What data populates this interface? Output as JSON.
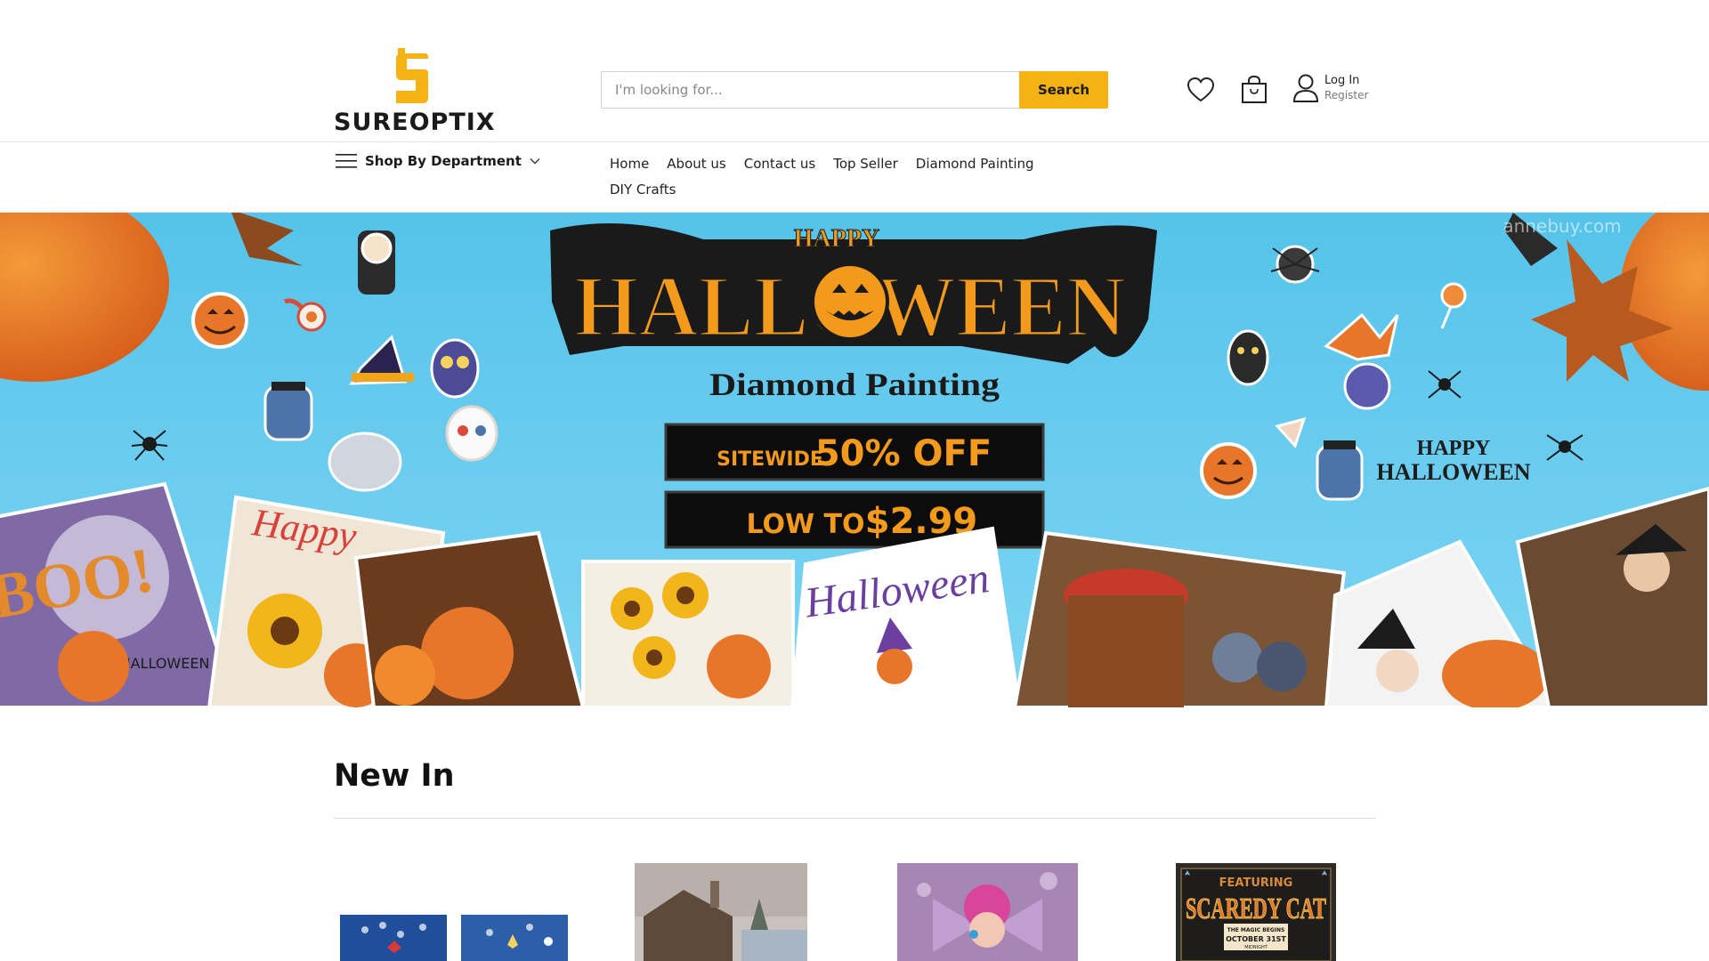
{
  "brand": {
    "name": "SUREOPTIX",
    "logo_letter": "S",
    "accent_color": "#f5b313"
  },
  "search": {
    "placeholder": "I'm looking for...",
    "button_label": "Search"
  },
  "header_icons": [
    "heart-icon",
    "shopping-bag-icon",
    "user-icon"
  ],
  "account": {
    "login_label": "Log In",
    "register_label": "Register"
  },
  "nav": {
    "department_label": "Shop By Department",
    "items": [
      "Home",
      "About us",
      "Contact us",
      "Top Seller",
      "Diamond Painting",
      "DIY Crafts"
    ]
  },
  "banner": {
    "happy": "HAPPY",
    "headline": "HALLOWEEN",
    "subtitle": "Diamond Painting",
    "offer_prefix": "SITEWIDE",
    "offer_main": "50% OFF",
    "price_prefix": "LOW TO",
    "price_value": "$2.99",
    "watermark": "annebuy.com",
    "side_text_1": "HAPPY",
    "side_text_2": "HALLOWEEN",
    "card_text_boo": "BOO!",
    "card_text_halloween": "HALLOWEEN",
    "card_text_happy": "Happy",
    "card_text_halloween_script": "Halloween",
    "background_color": "#5bc6ec"
  },
  "new_in": {
    "title": "New In",
    "products": [
      {
        "name": "product-blue-flower-mandala"
      },
      {
        "name": "product-cabin-landscape"
      },
      {
        "name": "product-pink-fairy"
      },
      {
        "name": "product-scaredy-cat",
        "poster_top": "FEATURING",
        "poster_title": "SCAREDY CAT",
        "poster_line1": "THE MAGIC BEGINS",
        "poster_line2": "OCTOBER 31ST",
        "poster_line3": "MIDNIGHT"
      }
    ]
  }
}
